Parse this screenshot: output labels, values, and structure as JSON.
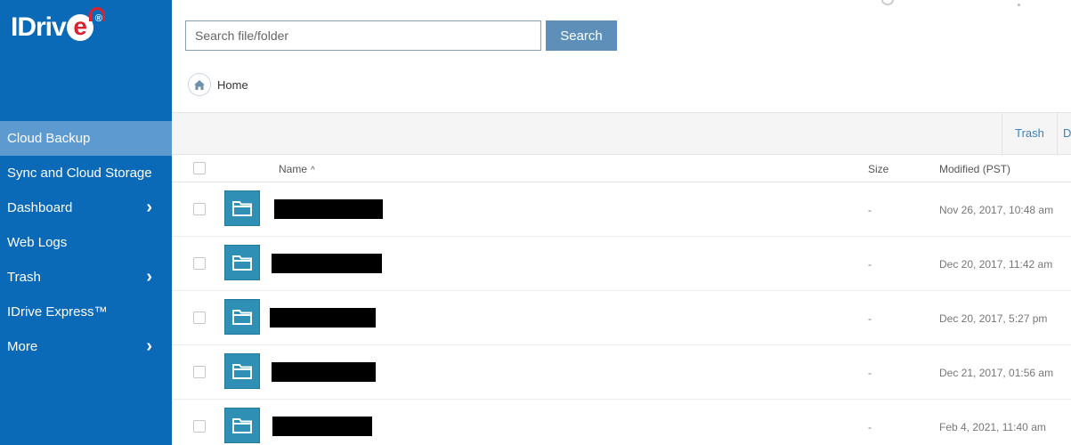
{
  "brand": {
    "name_main": "IDriv",
    "name_e": "e",
    "registered": "®"
  },
  "sidebar": {
    "items": [
      {
        "label": "Cloud Backup",
        "active": true,
        "has_chevron": false
      },
      {
        "label": "Sync and Cloud Storage",
        "active": false,
        "has_chevron": false
      },
      {
        "label": "Dashboard",
        "active": false,
        "has_chevron": true
      },
      {
        "label": "Web Logs",
        "active": false,
        "has_chevron": false
      },
      {
        "label": "Trash",
        "active": false,
        "has_chevron": true
      },
      {
        "label": "IDrive Express™",
        "active": false,
        "has_chevron": false
      },
      {
        "label": "More",
        "active": false,
        "has_chevron": true
      }
    ],
    "chevron_glyph": "›"
  },
  "search": {
    "placeholder": "Search file/folder",
    "value": "",
    "button_label": "Search"
  },
  "breadcrumb": {
    "home_label": "Home"
  },
  "toolbar": {
    "trash_label": "Trash",
    "more_label": "D"
  },
  "table": {
    "headers": {
      "name": "Name",
      "sort_indicator": "^",
      "size": "Size",
      "modified": "Modified (PST)"
    },
    "rows": [
      {
        "name": "",
        "size": "-",
        "modified": "Nov 26, 2017, 10:48 am"
      },
      {
        "name": "",
        "size": "-",
        "modified": "Dec 20, 2017, 11:42 am"
      },
      {
        "name": "",
        "size": "-",
        "modified": "Dec 20, 2017, 5:27 pm"
      },
      {
        "name": "",
        "size": "-",
        "modified": "Dec 21, 2017, 01:56 am"
      },
      {
        "name": "",
        "size": "-",
        "modified": "Feb 4, 2021, 11:40 am"
      }
    ]
  },
  "colors": {
    "sidebar_bg": "#0b6ab8",
    "sidebar_active": "#5d9ad0",
    "search_button": "#5d8fb8",
    "folder_icon": "#2f8fb4",
    "brand_red": "#d9232e"
  },
  "icons": {
    "home": "home-icon",
    "folder": "folder-icon",
    "chevron": "chevron-right-icon"
  }
}
